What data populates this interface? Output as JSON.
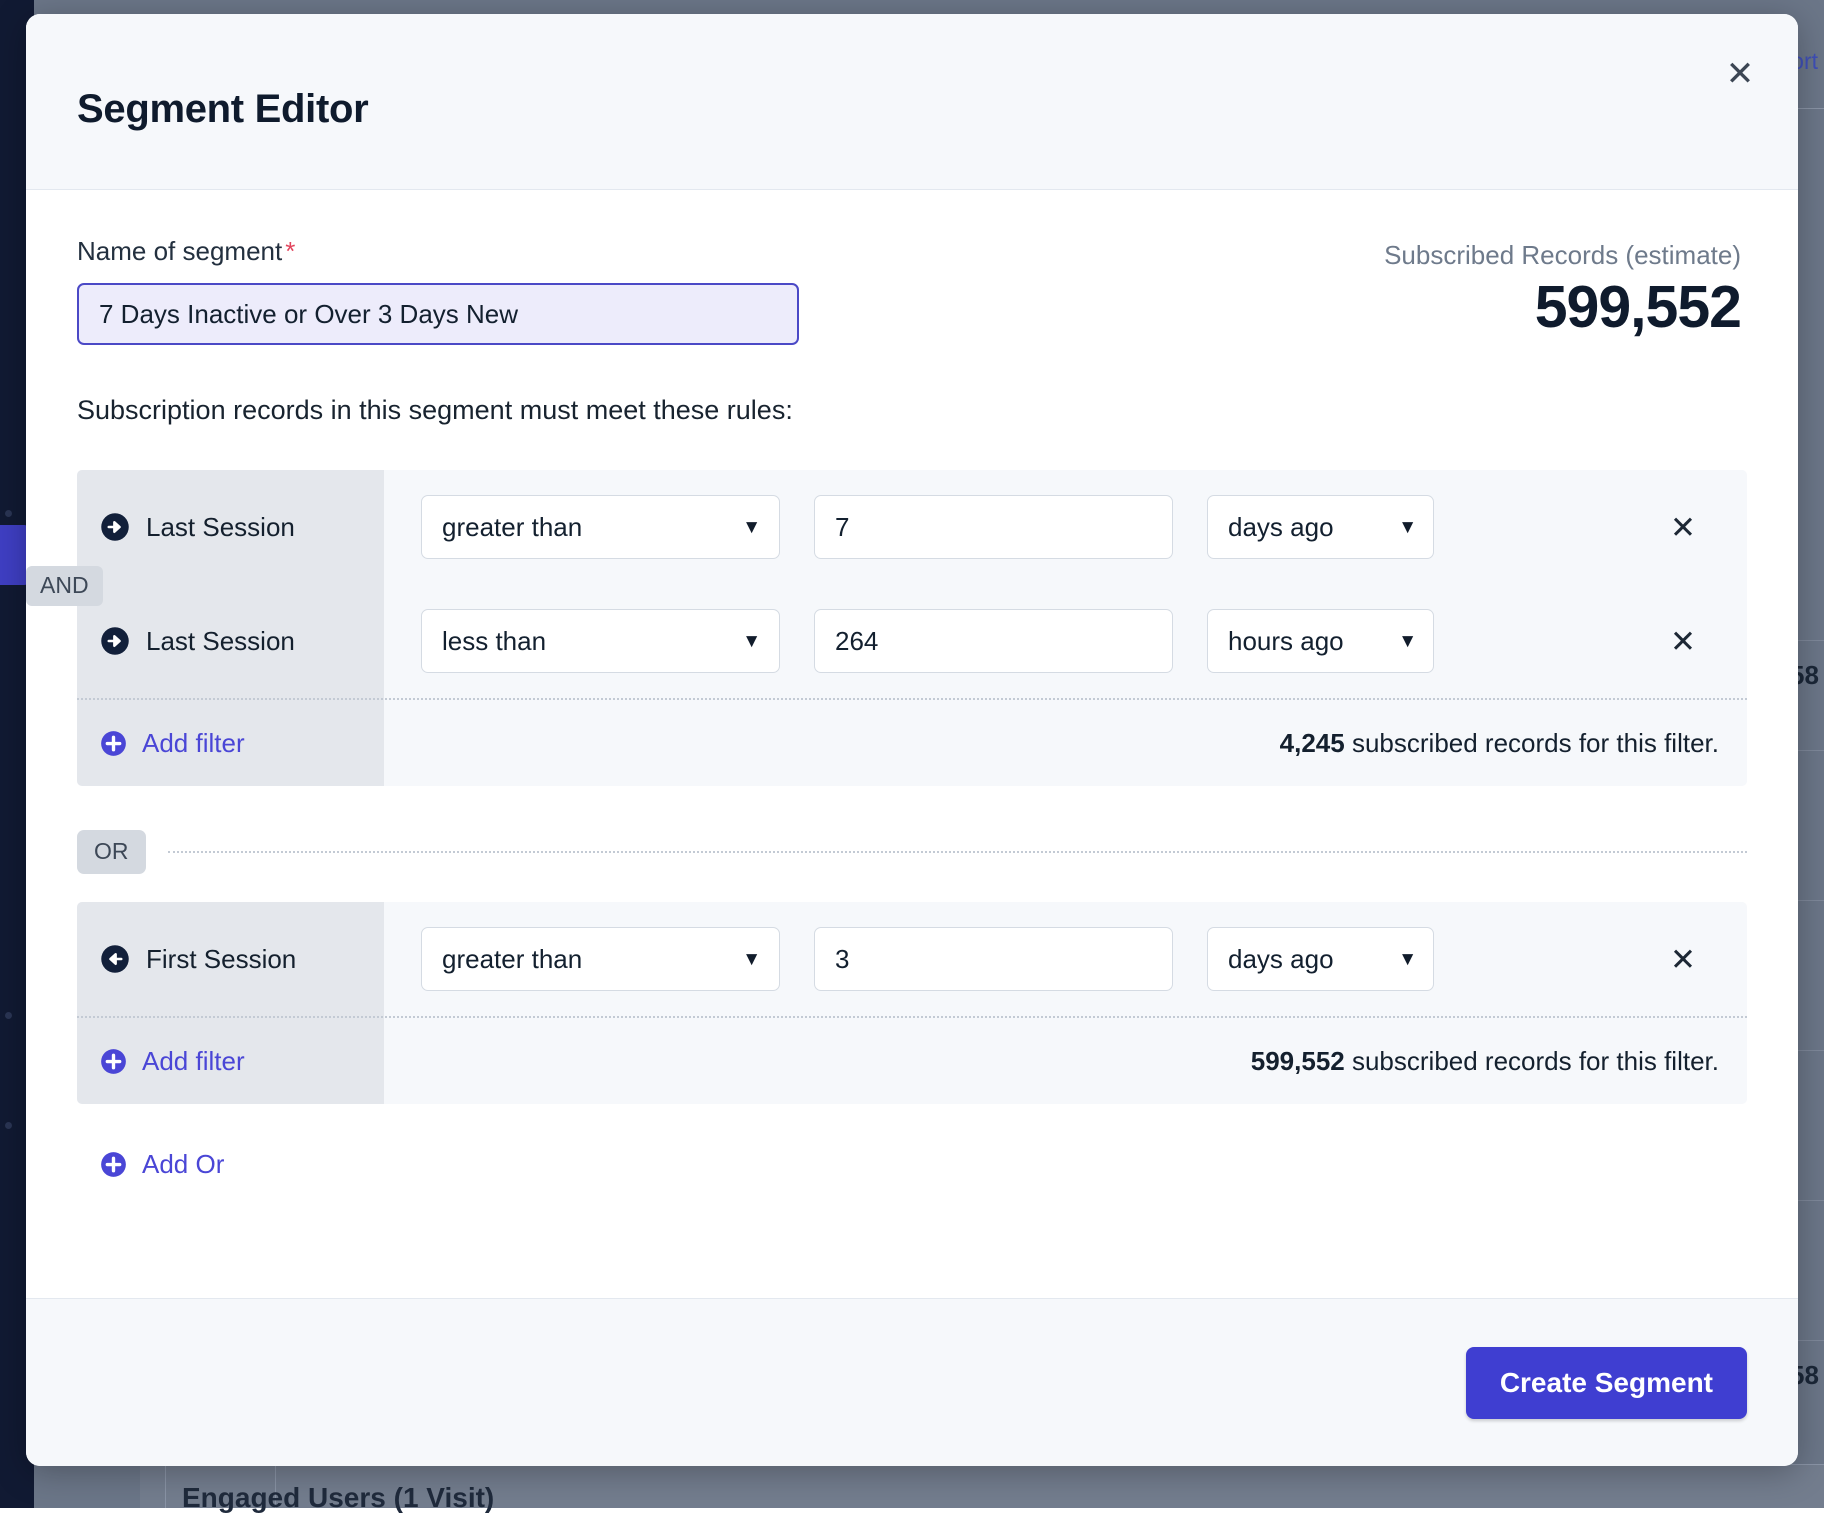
{
  "background": {
    "export_link": "ort",
    "bottom_row_label": "Engaged Users (1 Visit)",
    "right_column_values": [
      "58",
      "58"
    ],
    "sidebar_color": "#111a33",
    "active_item_color": "#3f3fc4"
  },
  "modal": {
    "title": "Segment Editor",
    "close_label": "✕"
  },
  "form": {
    "name_label": "Name of segment",
    "required_marker": "*",
    "name_value": "7 Days Inactive or Over 3 Days New",
    "name_placeholder": "Name of segment",
    "records_label": "Subscribed Records (estimate)",
    "records_value": "599,552",
    "rules_intro": "Subscription records in this segment must meet these rules:"
  },
  "groups": [
    {
      "join_badge": "AND",
      "rows": [
        {
          "field_label": "Last Session",
          "field_icon": "sign-in-arrow-right-icon",
          "operator": "greater than",
          "value": "7",
          "unit": "days ago",
          "remove_label": "✕"
        },
        {
          "field_label": "Last Session",
          "field_icon": "sign-in-arrow-right-icon",
          "operator": "less than",
          "value": "264",
          "unit": "hours ago",
          "remove_label": "✕"
        }
      ],
      "add_filter_label": "Add filter",
      "count_value": "4,245",
      "count_suffix": " subscribed records for this filter."
    },
    {
      "join_badge": "",
      "rows": [
        {
          "field_label": "First Session",
          "field_icon": "arrow-left-circle-icon",
          "operator": "greater than",
          "value": "3",
          "unit": "days ago",
          "remove_label": "✕"
        }
      ],
      "add_filter_label": "Add filter",
      "count_value": "599,552",
      "count_suffix": " subscribed records for this filter."
    }
  ],
  "or_separator": {
    "badge": "OR"
  },
  "add_or": {
    "label": "Add Or"
  },
  "footer": {
    "primary_label": "Create Segment",
    "primary_color": "#3f3ed1"
  },
  "operator_options": [
    "greater than",
    "less than"
  ],
  "unit_options": [
    "days ago",
    "hours ago"
  ]
}
